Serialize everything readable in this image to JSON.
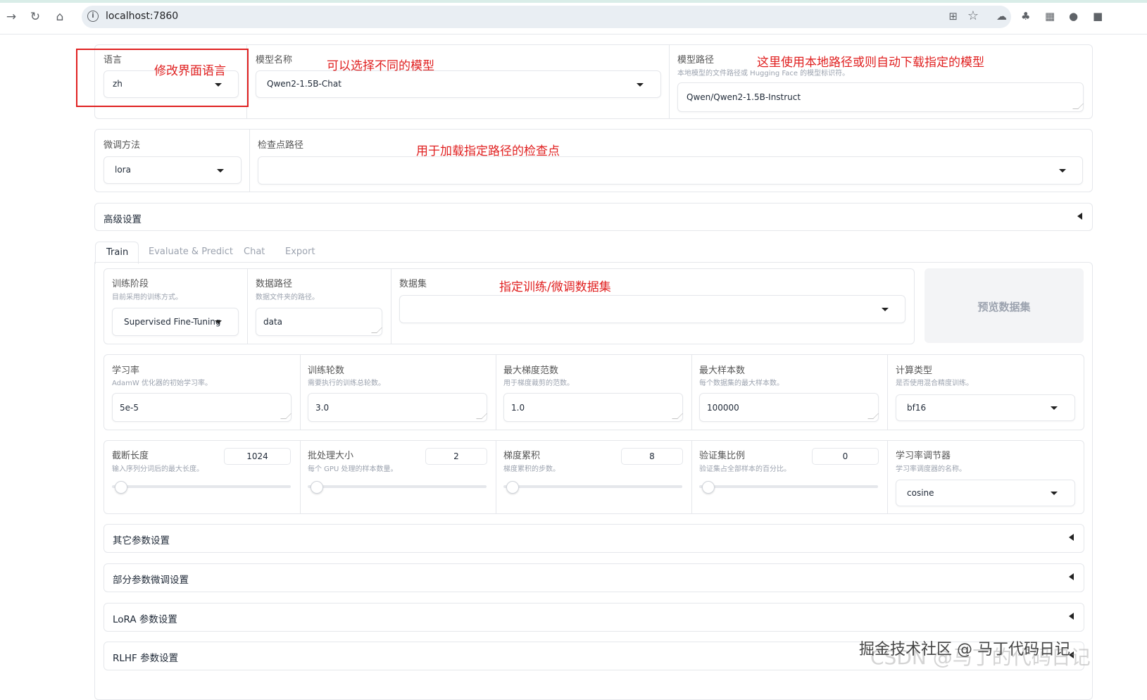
{
  "browser": {
    "url": "localhost:7860"
  },
  "top": {
    "lang_label": "语言",
    "lang_value": "zh",
    "model_name_label": "模型名称",
    "model_name_value": "Qwen2-1.5B-Chat",
    "model_path_label": "模型路径",
    "model_path_info": "本地模型的文件路径或 Hugging Face 的模型标识符。",
    "model_path_value": "Qwen/Qwen2-1.5B-Instruct"
  },
  "row2": {
    "finetune_label": "微调方法",
    "finetune_value": "lora",
    "checkpoint_label": "检查点路径",
    "checkpoint_value": ""
  },
  "advanced": {
    "label": "高级设置"
  },
  "tabs": [
    "Train",
    "Evaluate & Predict",
    "Chat",
    "Export"
  ],
  "train": {
    "stage_label": "训练阶段",
    "stage_info": "目前采用的训练方式。",
    "stage_value": "Supervised Fine-Tuning",
    "datadir_label": "数据路径",
    "datadir_info": "数据文件夹的路径。",
    "datadir_value": "data",
    "dataset_label": "数据集",
    "dataset_value": "",
    "preview_button": "预览数据集",
    "lr_label": "学习率",
    "lr_info": "AdamW 优化器的初始学习率。",
    "lr_value": "5e-5",
    "epochs_label": "训练轮数",
    "epochs_info": "需要执行的训练总轮数。",
    "epochs_value": "3.0",
    "maxgrad_label": "最大梯度范数",
    "maxgrad_info": "用于梯度裁剪的范数。",
    "maxgrad_value": "1.0",
    "maxsamples_label": "最大样本数",
    "maxsamples_info": "每个数据集的最大样本数。",
    "maxsamples_value": "100000",
    "compute_label": "计算类型",
    "compute_info": "是否使用混合精度训练。",
    "compute_value": "bf16",
    "cutoff_label": "截断长度",
    "cutoff_info": "输入序列分词后的最大长度。",
    "cutoff_value": "1024",
    "batch_label": "批处理大小",
    "batch_info": "每个 GPU 处理的样本数量。",
    "batch_value": "2",
    "gradacc_label": "梯度累积",
    "gradacc_info": "梯度累积的步数。",
    "gradacc_value": "8",
    "valsize_label": "验证集比例",
    "valsize_info": "验证集占全部样本的百分比。",
    "valsize_value": "0",
    "scheduler_label": "学习率调节器",
    "scheduler_info": "学习率调度器的名称。",
    "scheduler_value": "cosine",
    "slider_levels": {
      "cutoff": 0.0,
      "batch": 0.0,
      "gradacc": 0.0,
      "valsize": 0.0
    }
  },
  "accordions": [
    "其它参数设置",
    "部分参数微调设置",
    "LoRA 参数设置",
    "RLHF 参数设置"
  ],
  "annotations": {
    "lang": "修改界面语言",
    "model": "可以选择不同的模型",
    "path": "这里使用本地路径或则自动下载指定的模型",
    "checkpoint": "用于加载指定路径的检查点",
    "dataset": "指定训练/微调数据集"
  },
  "watermark": {
    "main": "掘金技术社区 @ 马丁代码日记",
    "faded": "CSDN @马丁的代码日记"
  },
  "colors": {
    "annotation": "#e02020",
    "annotation_box": "#e02020"
  }
}
